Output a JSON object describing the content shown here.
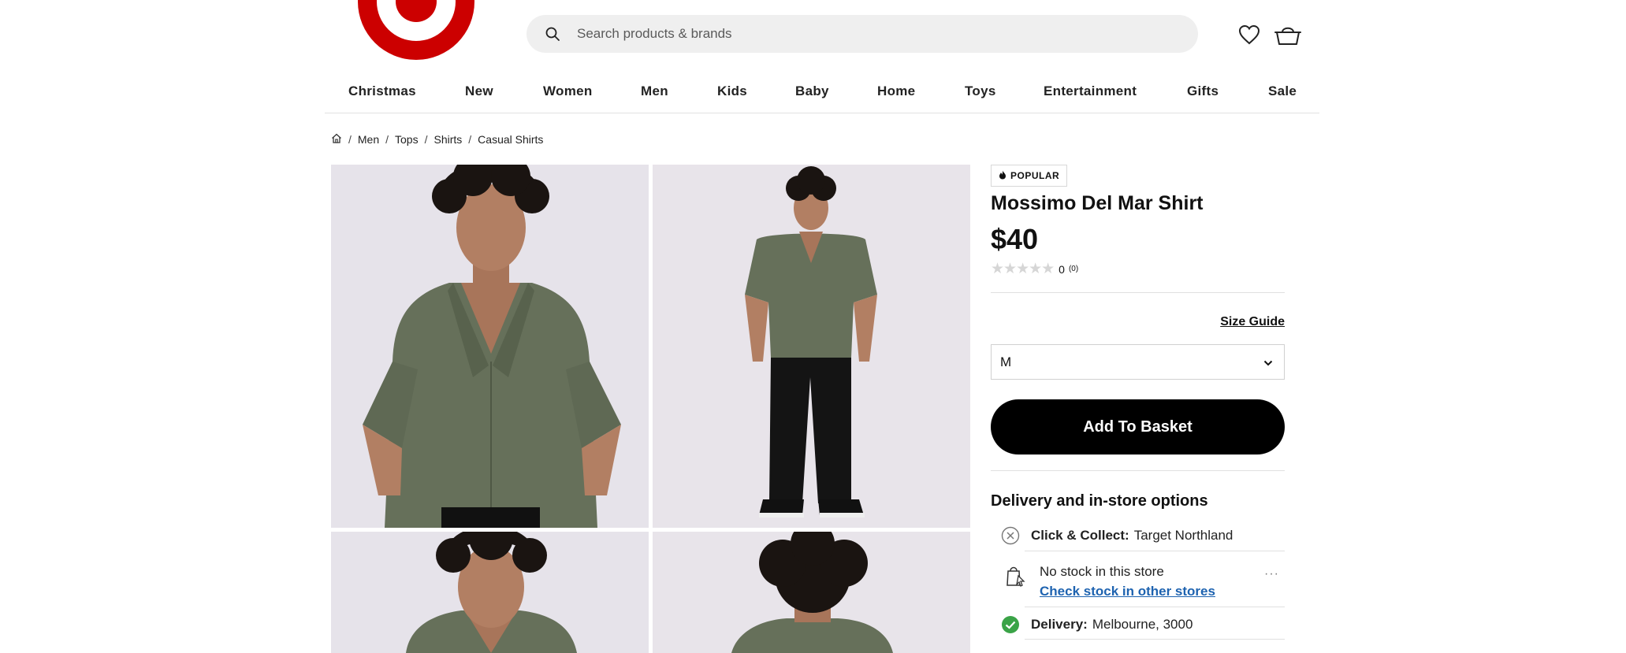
{
  "header": {
    "logo_name": "target-bullseye-logo",
    "search_placeholder": "Search products & brands",
    "icons": [
      "search-icon",
      "heart-icon",
      "basket-icon"
    ],
    "brand_color": "#cc0000"
  },
  "nav": {
    "items": [
      "Christmas",
      "New",
      "Women",
      "Men",
      "Kids",
      "Baby",
      "Home",
      "Toys",
      "Entertainment",
      "Gifts",
      "Sale"
    ]
  },
  "breadcrumb": {
    "home_icon": "home-icon",
    "items": [
      "Men",
      "Tops",
      "Shirts",
      "Casual Shirts"
    ]
  },
  "product": {
    "badge": "POPULAR",
    "badge_icon": "flame-icon",
    "title": "Mossimo Del Mar Shirt",
    "price": "$40",
    "rating_stars": "★★★★★",
    "rating_value": 0,
    "rating_label": "0",
    "review_count": "(0)",
    "size_guide": "Size Guide",
    "size_selected": "M",
    "add_to_basket": "Add To Basket",
    "shirt_color": "#66705a"
  },
  "delivery": {
    "title": "Delivery and in-store options",
    "click_collect_label": "Click & Collect:",
    "click_collect_value": "Target Northland",
    "store_status": "No stock in this store",
    "store_link": "Check stock in other stores",
    "delivery_label": "Delivery:",
    "delivery_value": "Melbourne, 3000",
    "more": "···",
    "available_color": "#3aa347"
  }
}
